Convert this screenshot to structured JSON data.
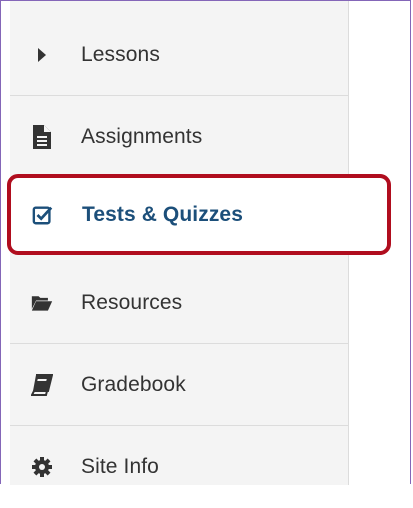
{
  "nav": {
    "items": [
      {
        "label": "Lessons",
        "icon": "caret-right-icon"
      },
      {
        "label": "Assignments",
        "icon": "file-text-icon"
      },
      {
        "label": "Tests & Quizzes",
        "icon": "check-square-icon",
        "active": true
      },
      {
        "label": "Resources",
        "icon": "folder-open-icon"
      },
      {
        "label": "Gradebook",
        "icon": "book-icon"
      },
      {
        "label": "Site Info",
        "icon": "gear-icon"
      }
    ]
  },
  "colors": {
    "highlight_border": "#b00d1e",
    "active_text": "#1c4f7a",
    "icon": "#333333"
  }
}
